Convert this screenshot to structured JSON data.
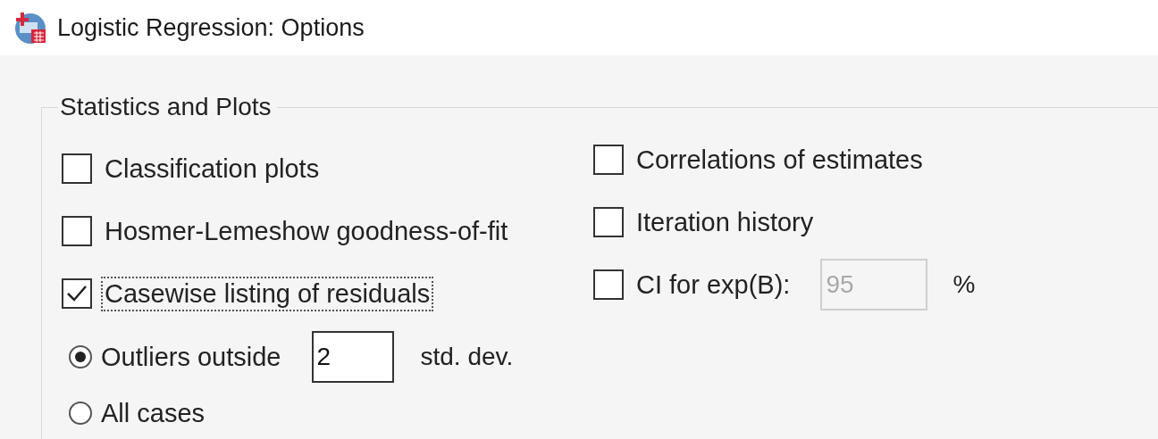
{
  "window": {
    "title": "Logistic Regression: Options"
  },
  "group": {
    "title": "Statistics and Plots",
    "left": [
      {
        "kind": "checkbox",
        "label": "Classification plots",
        "checked": false,
        "focused": false
      },
      {
        "kind": "checkbox",
        "label": "Hosmer-Lemeshow goodness-of-fit",
        "checked": false,
        "focused": false
      },
      {
        "kind": "checkbox",
        "label": "Casewise listing of residuals",
        "checked": true,
        "focused": true
      },
      {
        "kind": "radio",
        "label": "Outliers outside",
        "selected": true,
        "value": "2",
        "unit": "std. dev."
      },
      {
        "kind": "radio",
        "label": "All cases",
        "selected": false
      }
    ],
    "right": [
      {
        "kind": "checkbox",
        "label": "Correlations of estimates",
        "checked": false,
        "focused": false
      },
      {
        "kind": "checkbox",
        "label": "Iteration history",
        "checked": false,
        "focused": false
      },
      {
        "kind": "checkbox",
        "label": "CI for exp(B):",
        "checked": false,
        "focused": false,
        "value": "95",
        "value_disabled": true,
        "unit": "%"
      }
    ]
  }
}
